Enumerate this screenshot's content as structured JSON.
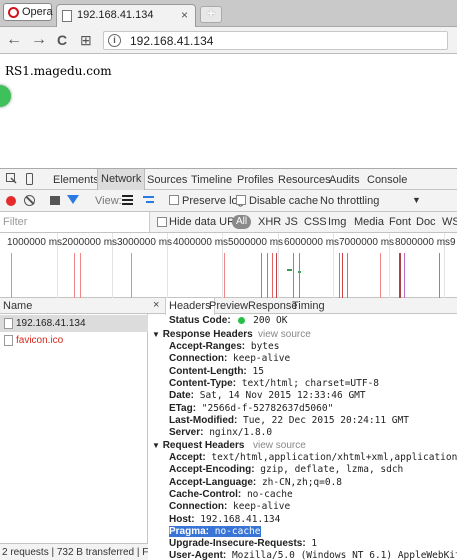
{
  "browser": {
    "opera_label": "Opera",
    "tab_title": "192.168.41.134",
    "tab_close": "×",
    "new_tab": "+",
    "nav": {
      "back": "←",
      "forward": "→",
      "reload": "C",
      "apps": "⊞"
    },
    "url": "192.168.41.134"
  },
  "page": {
    "text": "RS1.magedu.com"
  },
  "devtools": {
    "tabs": [
      "Elements",
      "Network",
      "Sources",
      "Timeline",
      "Profiles",
      "Resources",
      "Audits",
      "Console"
    ],
    "toolbar": {
      "view_label": "View:",
      "preserve_log": "Preserve log",
      "disable_cache": "Disable cache",
      "throttling": "No throttling",
      "throttle_arrow": "▼"
    },
    "filter": {
      "placeholder": "Filter",
      "hide_data_urls": "Hide data URLs",
      "types": [
        "All",
        "XHR",
        "JS",
        "CSS",
        "Img",
        "Media",
        "Font",
        "Doc",
        "WS"
      ]
    },
    "timeline": {
      "ticks": [
        "1000000 ms",
        "2000000 ms",
        "3000000 ms",
        "4000000 ms",
        "5000000 ms",
        "6000000 ms",
        "7000000 ms",
        "8000000 ms",
        "9"
      ]
    },
    "requests": {
      "column_name": "Name",
      "rows": [
        {
          "name": "192.168.41.134",
          "color": "#222222",
          "selected": true
        },
        {
          "name": "favicon.ico",
          "color": "#d7261c",
          "selected": false
        }
      ],
      "status": "2 requests | 732 B transferred | Fi..."
    },
    "detail": {
      "close": "×",
      "tabs": [
        "Headers",
        "Preview",
        "Response",
        "Timing"
      ],
      "status_code_label": "Status Code:",
      "status_code_value": "200 OK",
      "response_headers_title": "Response Headers",
      "request_headers_title": "Request Headers",
      "view_source": "view source",
      "response_headers": [
        {
          "k": "Accept-Ranges:",
          "v": "bytes"
        },
        {
          "k": "Connection:",
          "v": "keep-alive"
        },
        {
          "k": "Content-Length:",
          "v": "15"
        },
        {
          "k": "Content-Type:",
          "v": "text/html; charset=UTF-8"
        },
        {
          "k": "Date:",
          "v": "Sat, 14 Nov 2015 12:33:46 GMT"
        },
        {
          "k": "ETag:",
          "v": "\"2566d-f-52782637d5060\""
        },
        {
          "k": "Last-Modified:",
          "v": "Tue, 22 Dec 2015 20:24:11 GMT"
        },
        {
          "k": "Server:",
          "v": "nginx/1.8.0"
        }
      ],
      "request_headers": [
        {
          "k": "Accept:",
          "v": "text/html,application/xhtml+xml,application/xml;"
        },
        {
          "k": "Accept-Encoding:",
          "v": "gzip, deflate, lzma, sdch"
        },
        {
          "k": "Accept-Language:",
          "v": "zh-CN,zh;q=0.8"
        },
        {
          "k": "Cache-Control:",
          "v": "no-cache"
        },
        {
          "k": "Connection:",
          "v": "keep-alive"
        },
        {
          "k": "Host:",
          "v": "192.168.41.134"
        },
        {
          "k": "Pragma:",
          "v": "no-cache",
          "selected": true
        },
        {
          "k": "Upgrade-Insecure-Requests:",
          "v": "1"
        },
        {
          "k": "User-Agent:",
          "v": "Mozilla/5.0 (Windows NT 6.1) AppleWebKit/537"
        }
      ]
    }
  }
}
